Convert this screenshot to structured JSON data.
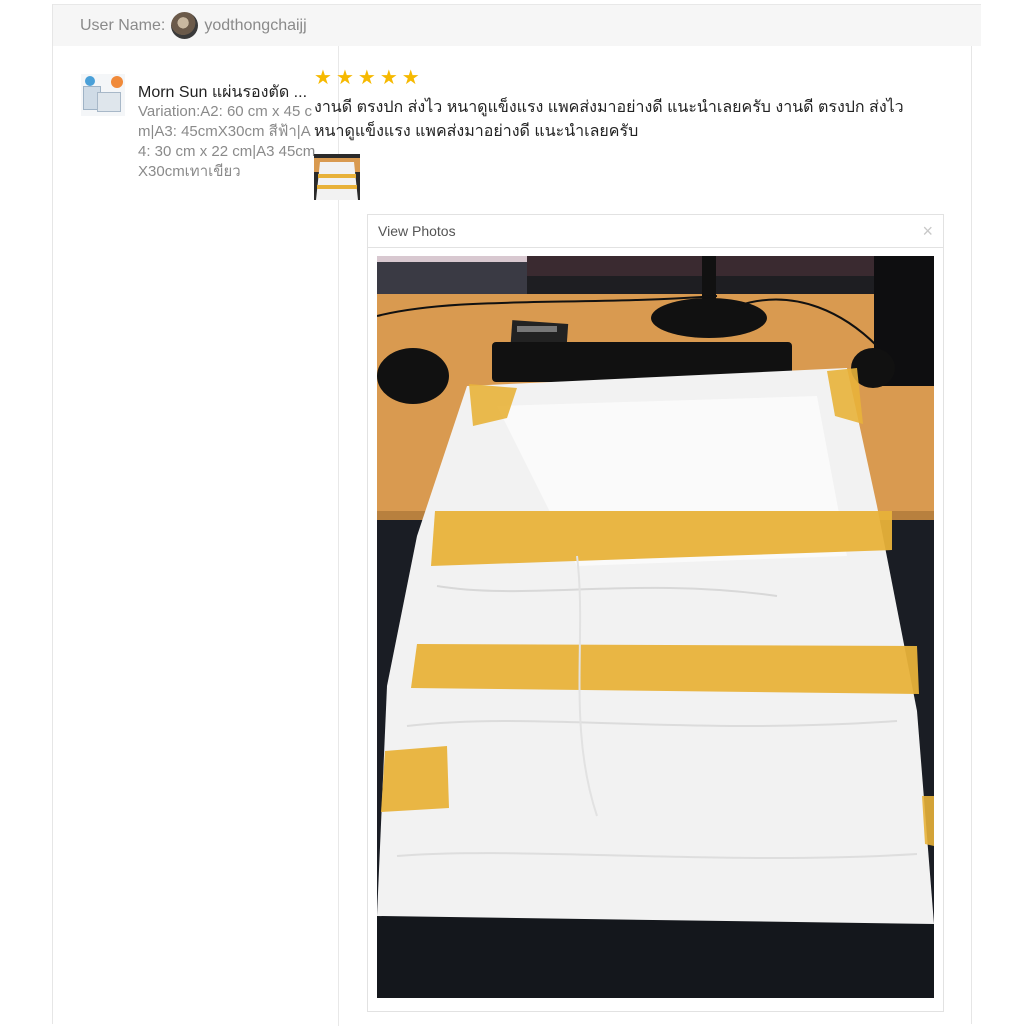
{
  "header": {
    "user_label": "User Name:",
    "username": "yodthongchaijj"
  },
  "product": {
    "name": "Morn Sun แผ่นรองตัด ...",
    "variation": "Variation:A2: 60 cm x 45 cm|A3: 45cmX30cm สีฟ้า|A4: 30 cm x 22 cm|A3 45cmX30cmเทาเขียว"
  },
  "review": {
    "rating": 5,
    "stars": [
      "★",
      "★",
      "★",
      "★",
      "★"
    ],
    "text": "งานดี ตรงปก ส่งไว หนาดูแข็งแรง แพคส่งมาอย่างดี แนะนำเลยครับ งานดี ตรงปก ส่งไว หนาดูแข็งแรง แพคส่งมาอย่างดี แนะนำเลยครับ"
  },
  "viewer": {
    "title": "View Photos",
    "close_icon": "×"
  },
  "colors": {
    "star": "#f6b900",
    "tape": "#e8b23a",
    "desk": "#d99a50",
    "package": "#f2f2f2"
  }
}
